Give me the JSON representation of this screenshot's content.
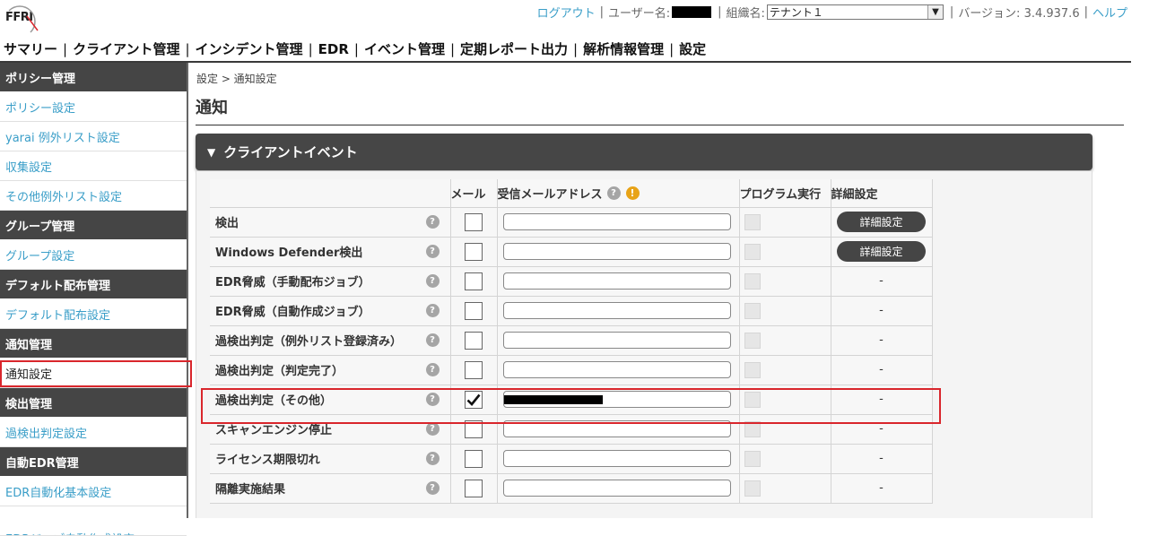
{
  "header": {
    "logo_text": "FFRI",
    "logout": "ログアウト",
    "user_label": "ユーザー名:",
    "org_label": "組織名:",
    "org_value": "テナント１",
    "version": "バージョン: 3.4.937.6",
    "help": "ヘルプ"
  },
  "nav": [
    {
      "label": "サマリー"
    },
    {
      "label": "クライアント管理"
    },
    {
      "label": "インシデント管理"
    },
    {
      "label": "EDR"
    },
    {
      "label": "イベント管理"
    },
    {
      "label": "定期レポート出力"
    },
    {
      "label": "解析情報管理"
    },
    {
      "label": "設定"
    }
  ],
  "sidebar": {
    "groups": [
      {
        "title": "ポリシー管理",
        "items": [
          "ポリシー設定",
          "yarai 例外リスト設定",
          "収集設定",
          "その他例外リスト設定"
        ]
      },
      {
        "title": "グループ管理",
        "items": [
          "グループ設定"
        ]
      },
      {
        "title": "デフォルト配布管理",
        "items": [
          "デフォルト配布設定"
        ]
      },
      {
        "title": "通知管理",
        "items": [
          "通知設定"
        ]
      },
      {
        "title": "検出管理",
        "items": [
          "過検出判定設定"
        ]
      },
      {
        "title": "自動EDR管理",
        "items": [
          "EDR自動化基本設定",
          "EDRジョブ自動作成設定"
        ]
      }
    ],
    "active_item": "通知設定"
  },
  "breadcrumb": "設定 > 通知設定",
  "page_title": "通知",
  "section": {
    "title": "クライアントイベント",
    "columns": {
      "mail": "メール",
      "address": "受信メールアドレス",
      "program": "プログラム実行",
      "detail": "詳細設定"
    },
    "rows": [
      {
        "name": "検出",
        "checked": false,
        "detail": "詳細設定"
      },
      {
        "name": "Windows Defender検出",
        "checked": false,
        "detail": "詳細設定"
      },
      {
        "name": "EDR脅威（手動配布ジョブ）",
        "checked": false,
        "detail": "-"
      },
      {
        "name": "EDR脅威（自動作成ジョブ）",
        "checked": false,
        "detail": "-"
      },
      {
        "name": "過検出判定（例外リスト登録済み）",
        "checked": false,
        "detail": "-"
      },
      {
        "name": "過検出判定（判定完了）",
        "checked": false,
        "detail": "-"
      },
      {
        "name": "過検出判定（その他）",
        "checked": true,
        "detail": "-"
      },
      {
        "name": "スキャンエンジン停止",
        "checked": false,
        "detail": "-"
      },
      {
        "name": "ライセンス期限切れ",
        "checked": false,
        "detail": "-"
      },
      {
        "name": "隔離実施結果",
        "checked": false,
        "detail": "-"
      }
    ]
  },
  "icons": {
    "help": "help-icon",
    "warning": "warning-icon",
    "checkmark": "checkmark-icon",
    "triangle": "triangle-down-icon"
  },
  "colors": {
    "link": "#3a9ec8",
    "dark": "#454545",
    "highlight": "#d9262c",
    "warning": "#e8a317"
  }
}
